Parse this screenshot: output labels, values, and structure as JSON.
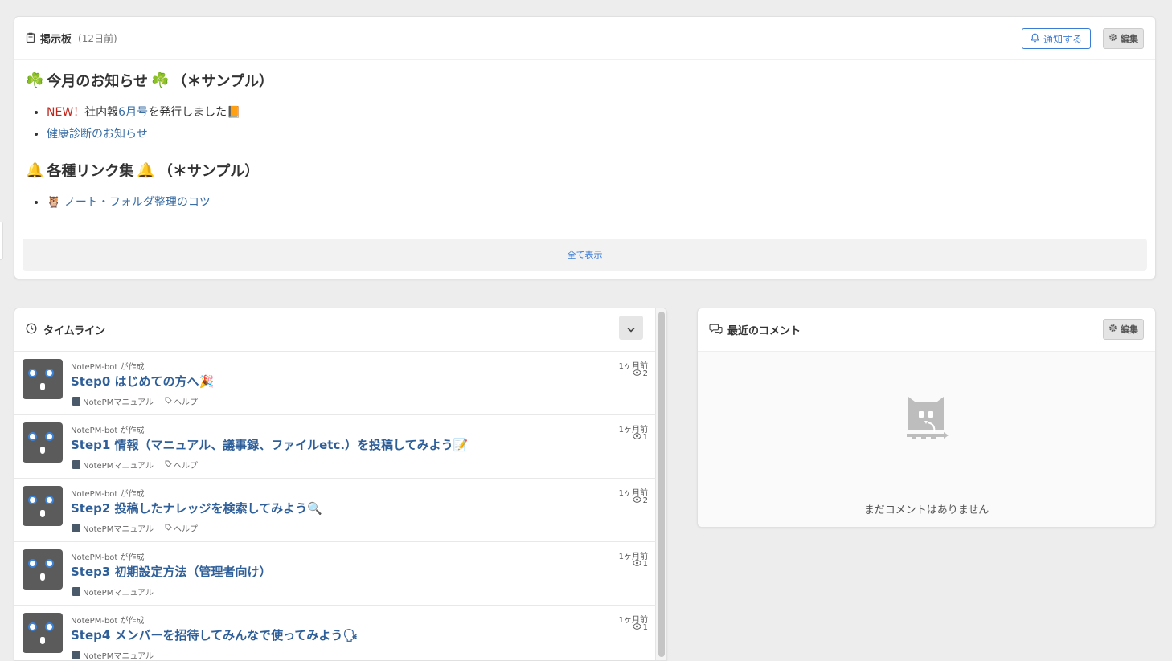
{
  "board": {
    "title": "掲示板",
    "ago": "(12日前)",
    "notify_label": "通知する",
    "edit_label": "編集",
    "section1_title": "今月のお知らせ",
    "section1_suffix": "（＊サンプル）",
    "item1_new": "NEW！",
    "item1_text_a": "社内報",
    "item1_link": "6月号",
    "item1_text_b": "を発行しました",
    "item2_link": "健康診断のお知らせ",
    "section2_title": "各種リンク集",
    "section2_suffix": "（＊サンプル）",
    "item3_link": "ノート・フォルダ整理のコツ",
    "show_all": "全て表示"
  },
  "timeline": {
    "title": "タイムライン",
    "rows": [
      {
        "meta": "NotePM-bot が作成",
        "title": "Step0 はじめての方へ🎉",
        "folder": "NotePMマニュアル",
        "tag": "ヘルプ",
        "time": "1ヶ月前",
        "views": "2"
      },
      {
        "meta": "NotePM-bot が作成",
        "title": "Step1 情報（マニュアル、議事録、ファイルetc.）を投稿してみよう📝",
        "folder": "NotePMマニュアル",
        "tag": "ヘルプ",
        "time": "1ヶ月前",
        "views": "1"
      },
      {
        "meta": "NotePM-bot が作成",
        "title": "Step2 投稿したナレッジを検索してみよう🔍",
        "folder": "NotePMマニュアル",
        "tag": "ヘルプ",
        "time": "1ヶ月前",
        "views": "2"
      },
      {
        "meta": "NotePM-bot が作成",
        "title": "Step3 初期設定方法（管理者向け）",
        "folder": "NotePMマニュアル",
        "tag": "",
        "time": "1ヶ月前",
        "views": "1"
      },
      {
        "meta": "NotePM-bot が作成",
        "title": "Step4 メンバーを招待してみんなで使ってみよう🗣",
        "folder": "NotePMマニュアル",
        "tag": "",
        "time": "1ヶ月前",
        "views": "1"
      }
    ]
  },
  "comments": {
    "title": "最近のコメント",
    "edit_label": "編集",
    "empty": "まだコメントはありません"
  },
  "colors": {
    "accent": "#3a7bd5",
    "link": "#2f5f99",
    "new": "#c0281e"
  },
  "icons": [
    "clipboard-icon",
    "bell-icon",
    "gear-icon",
    "clock-icon",
    "chevron-down-icon",
    "comment-icon",
    "eye-icon",
    "tag-icon",
    "folder-icon",
    "owl-icon"
  ]
}
